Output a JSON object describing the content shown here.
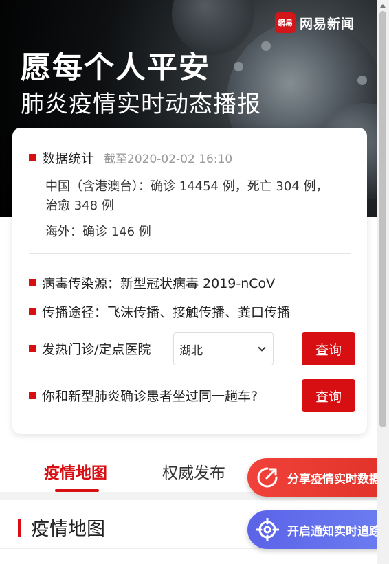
{
  "brand": {
    "logo_mark": "網易",
    "name": "网易新闻"
  },
  "banner": {
    "title": "愿每个人平安",
    "subtitle": "肺炎疫情实时动态播报"
  },
  "stats": {
    "heading": "数据统计",
    "as_of": "截至2020-02-02 16:10",
    "china": "中国（含港澳台）：确诊 14454 例，死亡 304 例，治愈 348 例",
    "overseas": "海外：确诊 146 例"
  },
  "info": {
    "source": "病毒传染源：新型冠状病毒 2019-nCoV",
    "route": "传播途径：飞沫传播、接触传播、粪口传播",
    "hospital_label": "发热门诊/定点医院",
    "region_select": "湖北",
    "query_label": "查询",
    "train_label": "你和新型肺炎确诊患者坐过同一趟车?",
    "train_query_label": "查询"
  },
  "tabs": [
    {
      "label": "疫情地图",
      "active": true
    },
    {
      "label": "权威发布",
      "active": false
    }
  ],
  "section": {
    "title": "疫情地图"
  },
  "floating": {
    "share": "分享疫情实时数据",
    "notify": "开启通知实时追踪"
  },
  "colors": {
    "accent": "#d70e12",
    "share_bg": "#e13329",
    "notify_bg": "#6270ec"
  },
  "icons": [
    "share-arrow-icon",
    "crosshair-target-icon",
    "chevron-down-icon"
  ]
}
